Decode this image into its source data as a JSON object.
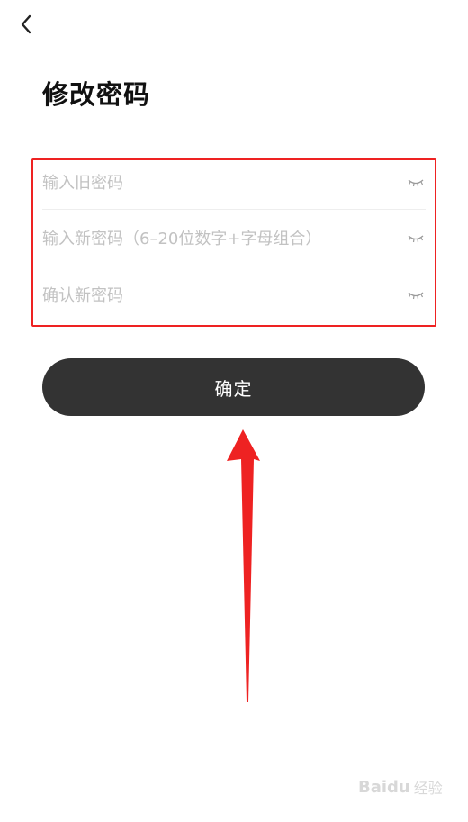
{
  "header": {
    "back_icon": "chevron-left-icon",
    "title": "修改密码"
  },
  "form": {
    "fields": [
      {
        "placeholder": "输入旧密码",
        "value": "",
        "toggle_icon": "eye-closed-icon"
      },
      {
        "placeholder": "输入新密码（6–20位数字+字母组合）",
        "value": "",
        "toggle_icon": "eye-closed-icon"
      },
      {
        "placeholder": "确认新密码",
        "value": "",
        "toggle_icon": "eye-closed-icon"
      }
    ],
    "highlight_color": "#ee2222"
  },
  "confirm_button": {
    "label": "确定",
    "background": "#333333"
  },
  "annotation": {
    "arrow_icon": "red-up-arrow",
    "color": "#ee2222"
  },
  "watermark": {
    "brand": "Baidu",
    "sub": "经验"
  }
}
